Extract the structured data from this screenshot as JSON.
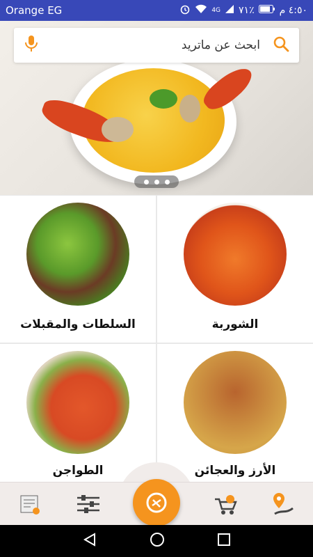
{
  "status_bar": {
    "carrier": "Orange EG",
    "time": "٤:٥٠ م",
    "battery": "٧١٪",
    "network": "4G"
  },
  "search": {
    "placeholder": "ابحث عن ماتريد",
    "accent_color": "#f5941e"
  },
  "banner": {
    "page_count": 3
  },
  "categories": [
    {
      "label": "الشوربة",
      "icon": "shrimp-soup-photo"
    },
    {
      "label": "السلطات والمقبلات",
      "icon": "salad-photo"
    },
    {
      "label": "الأرز والعجائن",
      "icon": "rice-chicken-photo"
    },
    {
      "label": "الطواجن",
      "icon": "casserole-photo"
    }
  ],
  "bottom_nav": {
    "items": [
      {
        "name": "location-route-icon"
      },
      {
        "name": "delivery-cart-icon"
      },
      {
        "name": "main-menu-fab-icon"
      },
      {
        "name": "filter-sliders-icon"
      },
      {
        "name": "restaurant-menu-icon"
      }
    ]
  },
  "colors": {
    "status_bar": "#3848b8",
    "accent": "#f5941e"
  }
}
